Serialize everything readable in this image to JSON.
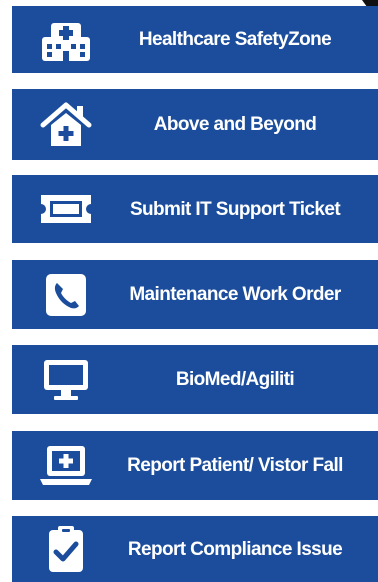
{
  "buttons": [
    {
      "label": "Healthcare SafetyZone",
      "icon": "hospital-building-icon"
    },
    {
      "label": "Above and Beyond",
      "icon": "house-plus-icon"
    },
    {
      "label": "Submit IT Support Ticket",
      "icon": "ticket-icon"
    },
    {
      "label": "Maintenance Work Order",
      "icon": "phone-icon"
    },
    {
      "label": "BioMed/Agiliti",
      "icon": "monitor-icon"
    },
    {
      "label": "Report Patient/ Vistor Fall",
      "icon": "laptop-medical-icon"
    },
    {
      "label": "Report Compliance Issue",
      "icon": "clipboard-check-icon"
    }
  ],
  "colors": {
    "button_background": "#1b4d9c",
    "text": "#ffffff",
    "corner_mark": "#111111"
  }
}
